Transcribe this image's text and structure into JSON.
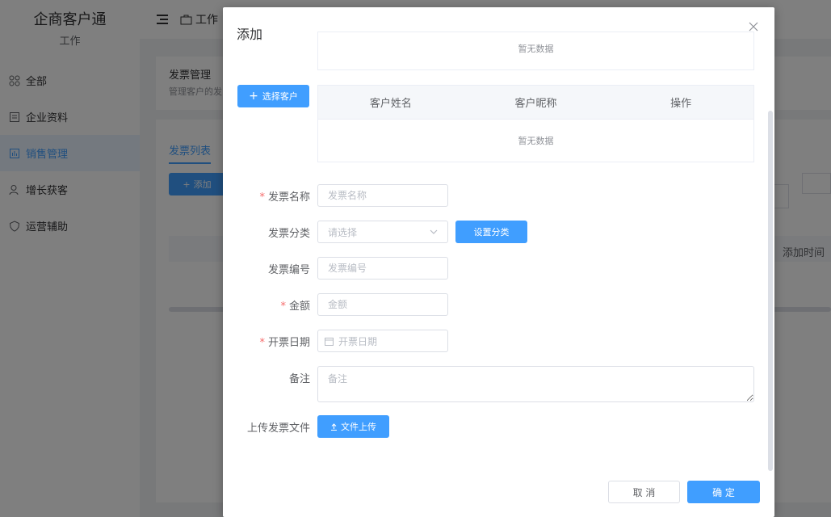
{
  "app": {
    "brand_title": "企商客户通",
    "brand_subtitle": "工作",
    "sidebar": [
      {
        "label": "全部",
        "icon": "grid-icon",
        "active": false
      },
      {
        "label": "企业资料",
        "icon": "document-icon",
        "active": false
      },
      {
        "label": "销售管理",
        "icon": "chart-icon",
        "active": true
      },
      {
        "label": "增长获客",
        "icon": "user-add-icon",
        "active": false
      },
      {
        "label": "运营辅助",
        "icon": "shield-icon",
        "active": false
      }
    ],
    "topbar": {
      "item_label": "工作"
    },
    "page": {
      "title": "发票管理",
      "subtitle": "管理客户的发",
      "tab": "发票列表",
      "add_button": "添加",
      "column_add_time": "添加时间"
    }
  },
  "dialog": {
    "title": "添加",
    "top_table_empty": "暂无数据",
    "select_customer_button": "选择客户",
    "customer_table": {
      "columns": [
        "客户姓名",
        "客户昵称",
        "操作"
      ],
      "empty_text": "暂无数据"
    },
    "form": {
      "invoice_name": {
        "label": "发票名称",
        "placeholder": "发票名称",
        "required": true
      },
      "invoice_category": {
        "label": "发票分类",
        "placeholder": "请选择",
        "button": "设置分类"
      },
      "invoice_number": {
        "label": "发票编号",
        "placeholder": "发票编号"
      },
      "amount": {
        "label": "金额",
        "placeholder": "金额",
        "required": true
      },
      "invoice_date": {
        "label": "开票日期",
        "placeholder": "开票日期",
        "required": true
      },
      "remark": {
        "label": "备注",
        "placeholder": "备注"
      },
      "upload": {
        "label": "上传发票文件",
        "button": "文件上传"
      }
    },
    "footer": {
      "cancel": "取 消",
      "confirm": "确 定"
    }
  },
  "colors": {
    "primary": "#409eff",
    "required": "#f56c6c",
    "border": "#dcdfe6"
  }
}
